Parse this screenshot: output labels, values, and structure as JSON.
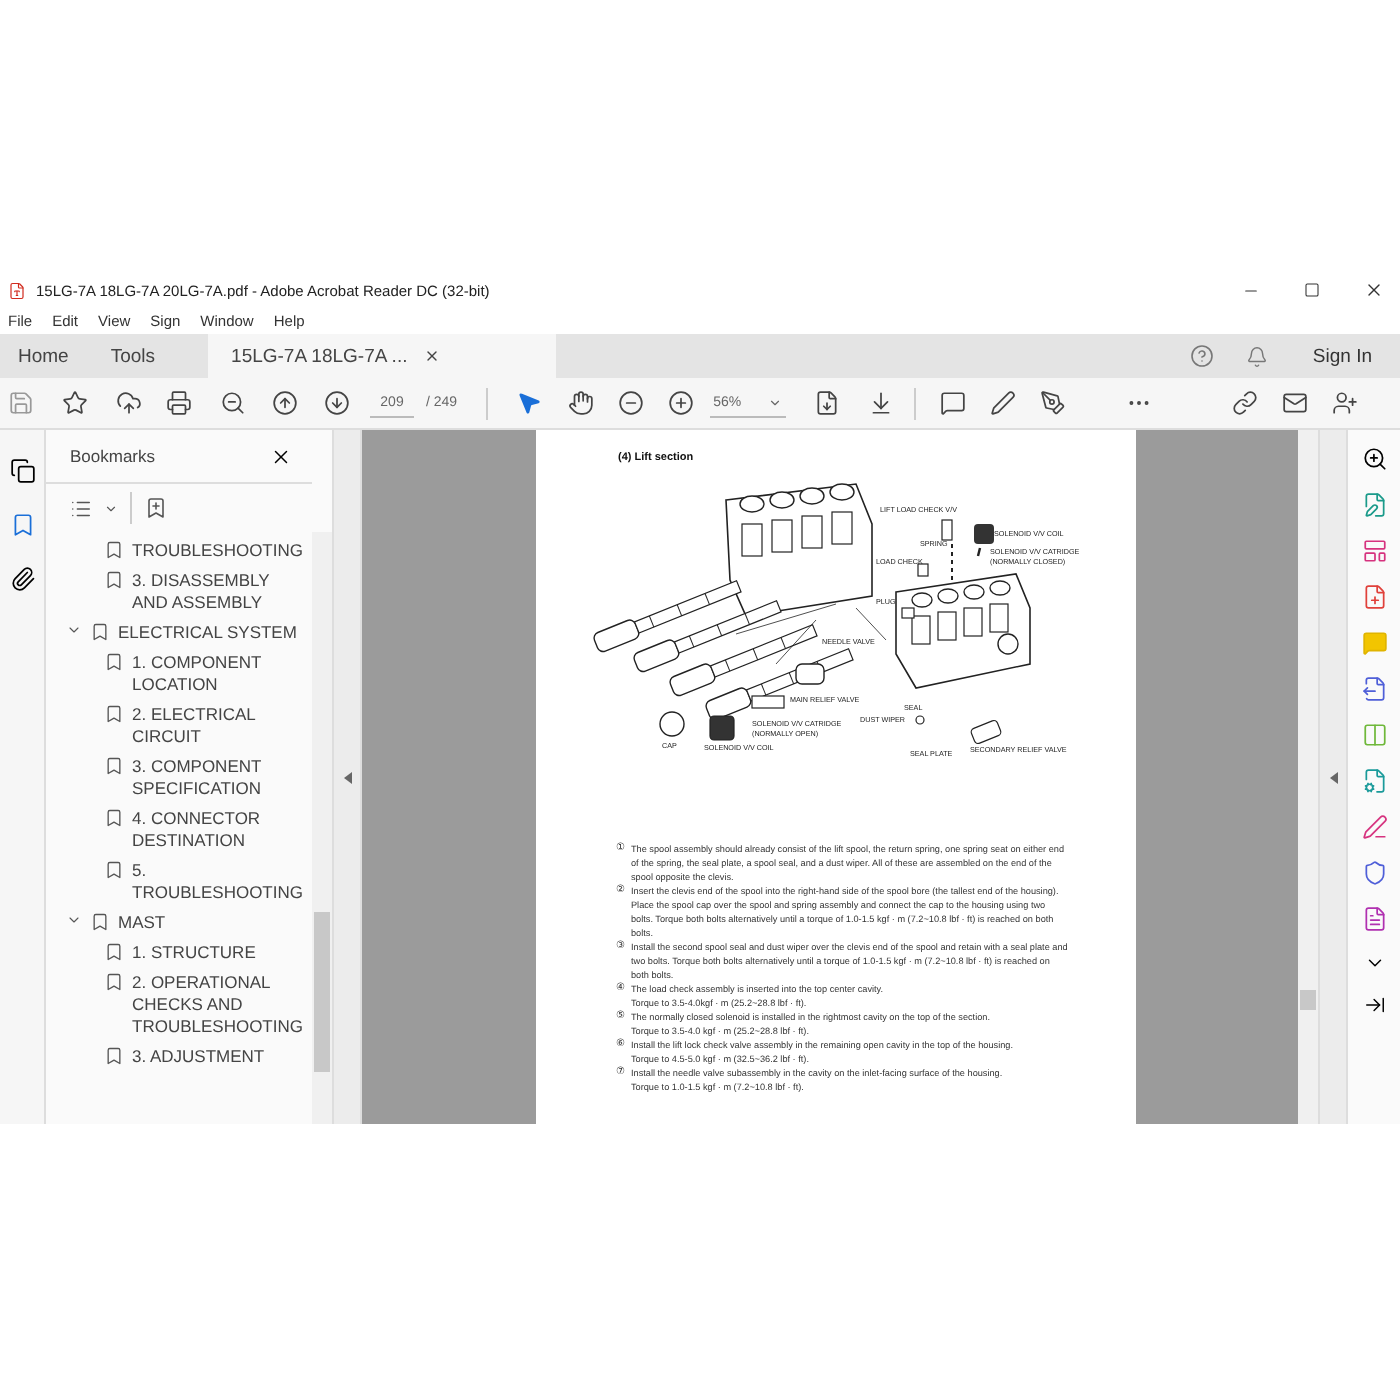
{
  "window": {
    "title": "15LG-7A 18LG-7A 20LG-7A.pdf - Adobe Acrobat Reader DC (32-bit)"
  },
  "menu": [
    "File",
    "Edit",
    "View",
    "Sign",
    "Window",
    "Help"
  ],
  "tabs": [
    {
      "label": "Home",
      "selected": false
    },
    {
      "label": "Tools",
      "selected": false
    },
    {
      "label": "15LG-7A 18LG-7A ...",
      "selected": true
    }
  ],
  "account": {
    "sign_in": "Sign In"
  },
  "toolbar": {
    "page": "209",
    "total": "/ 249",
    "zoom": "56%"
  },
  "bookmarks": {
    "title": "Bookmarks",
    "items": [
      {
        "expanded": true,
        "children": [
          {
            "label": "TROUBLESHOOTING"
          },
          {
            "label": "3. DISASSEMBLY AND ASSEMBLY"
          }
        ]
      },
      {
        "label": "ELECTRICAL SYSTEM",
        "expanded": true,
        "children": [
          {
            "label": "1. COMPONENT LOCATION"
          },
          {
            "label": "2. ELECTRICAL CIRCUIT"
          },
          {
            "label": "3. COMPONENT SPECIFICATION"
          },
          {
            "label": "4. CONNECTOR DESTINATION"
          },
          {
            "label": "5. TROUBLESHOOTING"
          }
        ]
      },
      {
        "label": "MAST",
        "expanded": true,
        "children": [
          {
            "label": "1. STRUCTURE"
          },
          {
            "label": "2. OPERATIONAL CHECKS AND TROUBLESHOOTING"
          },
          {
            "label": "3. ADJUSTMENT"
          }
        ]
      }
    ]
  },
  "document": {
    "heading": "(4) Lift section",
    "diagram_labels": [
      "LIFT LOAD CHECK V/V",
      "SOLENOID V/V COIL",
      "SPRING",
      "LOAD CHECK",
      "SOLENOID V/V CATRIDGE",
      "(NORMALLY CLOSED)",
      "PLUG",
      "NEEDLE VALVE",
      "MAIN RELIEF VALVE",
      "SOLENOID V/V CATRIDGE",
      "(NORMALLY OPEN)",
      "SEAL",
      "DUST WIPER",
      "CAP",
      "SOLENOID V/V COIL",
      "SEAL PLATE",
      "SECONDARY RELIEF VALVE"
    ],
    "steps": [
      {
        "marker": "①",
        "text": "The spool assembly should already consist of the lift spool, the return spring, one spring seat on either end of the spring, the seal plate, a spool seal, and a dust wiper. All of these are assembled on the end of the spool opposite the clevis."
      },
      {
        "marker": "②",
        "text": "Insert the clevis end of the spool into the right-hand side of the spool bore (the tallest end of the housing). Place the spool cap over the spool and spring assembly and connect the cap to the housing using two bolts. Torque both bolts alternatively until a torque of 1.0-1.5 kgf · m (7.2~10.8 lbf · ft) is reached on both bolts."
      },
      {
        "marker": "③",
        "text": "Install the second spool seal and dust wiper over the clevis end of the spool and retain with a seal plate and two bolts. Torque both bolts alternatively until a torque of 1.0-1.5 kgf · m (7.2~10.8 lbf · ft) is reached on both bolts."
      },
      {
        "marker": "④",
        "text": "The load check assembly is inserted into the top center cavity.",
        "torque": "Torque to 3.5-4.0kgf · m (25.2~28.8 lbf · ft)."
      },
      {
        "marker": "⑤",
        "text": "The normally closed solenoid is installed in the rightmost cavity on the top of the section.",
        "torque": "Torque to 3.5-4.0 kgf · m (25.2~28.8 lbf · ft)."
      },
      {
        "marker": "⑥",
        "text": "Install the lift lock check valve assembly in the remaining open cavity in the top of the housing.",
        "torque": "Torque to 4.5-5.0 kgf · m (32.5~36.2 lbf · ft)."
      },
      {
        "marker": "⑦",
        "text": "Install the needle valve subassembly in the cavity on the inlet-facing surface of the housing.",
        "torque": "Torque to 1.0-1.5 kgf · m (7.2~10.8 lbf · ft)."
      }
    ]
  }
}
